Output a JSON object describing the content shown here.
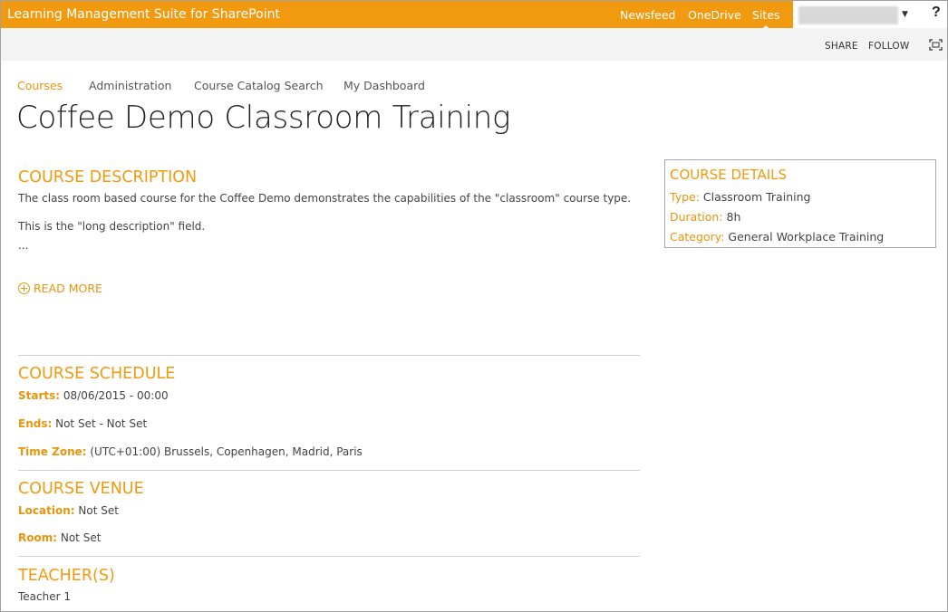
{
  "suite_bar": {
    "title": "Learning Management Suite for SharePoint",
    "links": [
      "Newsfeed",
      "OneDrive",
      "Sites"
    ],
    "active_link": "Sites",
    "help": "?"
  },
  "ribbon": {
    "share": "SHARE",
    "follow": "FOLLOW"
  },
  "top_nav": {
    "items": [
      "Courses",
      "Administration",
      "Course Catalog Search",
      "My Dashboard"
    ],
    "selected": "Courses"
  },
  "page_title": "Coffee Demo Classroom Training",
  "course_description": {
    "heading": "COURSE DESCRIPTION",
    "line1": "The class room based course for the Coffee Demo demonstrates the capabilities of the \"classroom\" course type.",
    "line2": "This is the \"long description\" field.",
    "ellipsis": "...",
    "read_more": "READ MORE"
  },
  "course_schedule": {
    "heading": "COURSE SCHEDULE",
    "starts_label": "Starts:",
    "starts_value": "08/06/2015 - 00:00",
    "ends_label": "Ends:",
    "ends_value": "Not Set - Not Set",
    "timezone_label": "Time Zone:",
    "timezone_value": "(UTC+01:00) Brussels, Copenhagen, Madrid, Paris"
  },
  "course_venue": {
    "heading": "COURSE VENUE",
    "location_label": "Location:",
    "location_value": "Not Set",
    "room_label": "Room:",
    "room_value": "Not Set"
  },
  "teachers": {
    "heading": "TEACHER(S)",
    "items": [
      "Teacher 1"
    ]
  },
  "course_details": {
    "heading": "COURSE DETAILS",
    "type_label": "Type:",
    "type_value": "Classroom Training",
    "duration_label": "Duration:",
    "duration_value": "8h",
    "category_label": "Category:",
    "category_value": "General Workplace Training"
  },
  "colors": {
    "accent": "#f29a0f",
    "suite_bar": "#f29a0f",
    "ribbon": "#f3f3f3"
  }
}
